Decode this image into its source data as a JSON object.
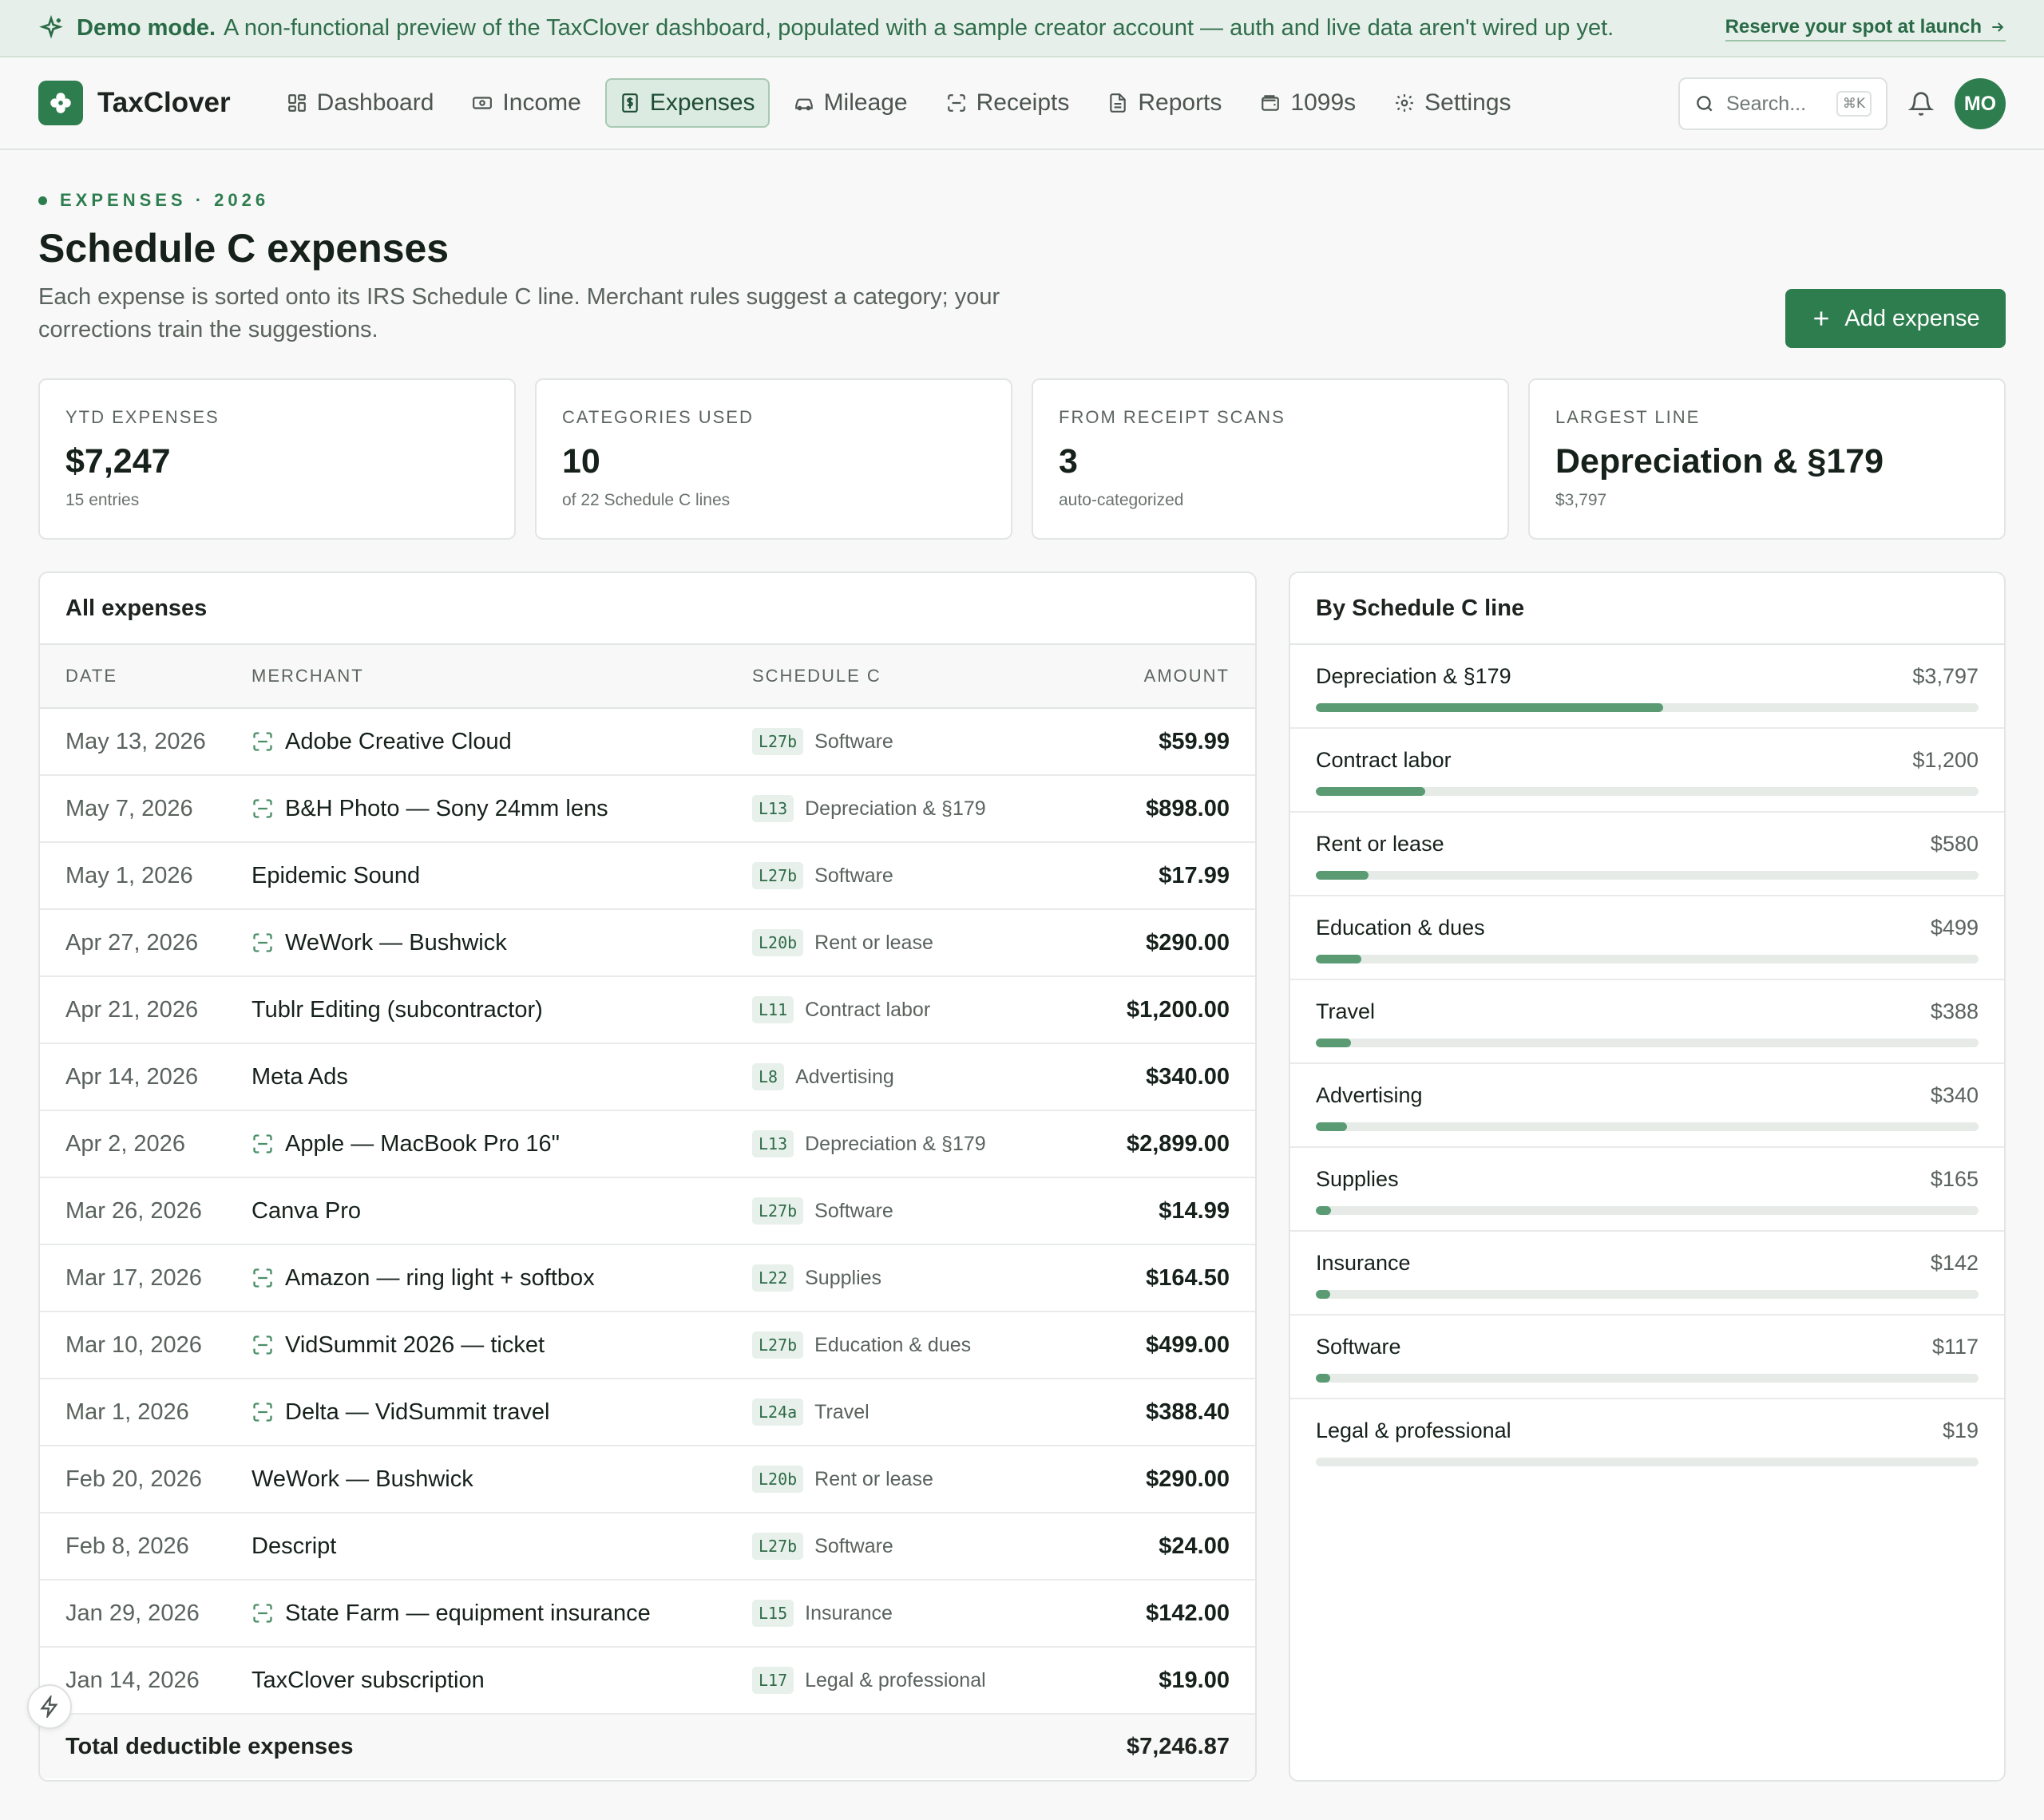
{
  "banner": {
    "strong": "Demo mode.",
    "message": "A non-functional preview of the TaxClover dashboard, populated with a sample creator account — auth and live data aren't wired up yet.",
    "cta": "Reserve your spot at launch"
  },
  "header": {
    "brand": "TaxClover",
    "nav": [
      {
        "label": "Dashboard",
        "icon": "grid-icon"
      },
      {
        "label": "Income",
        "icon": "cash-icon"
      },
      {
        "label": "Expenses",
        "icon": "receipt-dollar-icon",
        "active": true
      },
      {
        "label": "Mileage",
        "icon": "car-icon"
      },
      {
        "label": "Receipts",
        "icon": "scan-icon"
      },
      {
        "label": "Reports",
        "icon": "document-icon"
      },
      {
        "label": "1099s",
        "icon": "wallet-icon"
      },
      {
        "label": "Settings",
        "icon": "gear-icon"
      }
    ],
    "search_placeholder": "Search...",
    "search_shortcut": "⌘K",
    "avatar_initials": "MO"
  },
  "page": {
    "eyebrow": "EXPENSES · 2026",
    "title": "Schedule C expenses",
    "subtitle": "Each expense is sorted onto its IRS Schedule C line. Merchant rules suggest a category; your corrections train the suggestions.",
    "add_button": "Add expense"
  },
  "stats": [
    {
      "label": "YTD EXPENSES",
      "value": "$7,247",
      "note": "15 entries"
    },
    {
      "label": "CATEGORIES USED",
      "value": "10",
      "note": "of 22 Schedule C lines"
    },
    {
      "label": "FROM RECEIPT SCANS",
      "value": "3",
      "note": "auto-categorized"
    },
    {
      "label": "LARGEST LINE",
      "value": "Depreciation & §179",
      "note": "$3,797"
    }
  ],
  "expenses": {
    "title": "All expenses",
    "columns": [
      "DATE",
      "MERCHANT",
      "SCHEDULE C",
      "AMOUNT"
    ],
    "rows": [
      {
        "date": "May 13, 2026",
        "merchant": "Adobe Creative Cloud",
        "scanned": true,
        "line": "L27b",
        "category": "Software",
        "amount": "$59.99"
      },
      {
        "date": "May 7, 2026",
        "merchant": "B&H Photo — Sony 24mm lens",
        "scanned": true,
        "line": "L13",
        "category": "Depreciation & §179",
        "amount": "$898.00"
      },
      {
        "date": "May 1, 2026",
        "merchant": "Epidemic Sound",
        "scanned": false,
        "line": "L27b",
        "category": "Software",
        "amount": "$17.99"
      },
      {
        "date": "Apr 27, 2026",
        "merchant": "WeWork — Bushwick",
        "scanned": true,
        "line": "L20b",
        "category": "Rent or lease",
        "amount": "$290.00"
      },
      {
        "date": "Apr 21, 2026",
        "merchant": "Tublr Editing (subcontractor)",
        "scanned": false,
        "line": "L11",
        "category": "Contract labor",
        "amount": "$1,200.00"
      },
      {
        "date": "Apr 14, 2026",
        "merchant": "Meta Ads",
        "scanned": false,
        "line": "L8",
        "category": "Advertising",
        "amount": "$340.00"
      },
      {
        "date": "Apr 2, 2026",
        "merchant": "Apple — MacBook Pro 16\"",
        "scanned": true,
        "line": "L13",
        "category": "Depreciation & §179",
        "amount": "$2,899.00"
      },
      {
        "date": "Mar 26, 2026",
        "merchant": "Canva Pro",
        "scanned": false,
        "line": "L27b",
        "category": "Software",
        "amount": "$14.99"
      },
      {
        "date": "Mar 17, 2026",
        "merchant": "Amazon — ring light + softbox",
        "scanned": true,
        "line": "L22",
        "category": "Supplies",
        "amount": "$164.50"
      },
      {
        "date": "Mar 10, 2026",
        "merchant": "VidSummit 2026 — ticket",
        "scanned": true,
        "line": "L27b",
        "category": "Education & dues",
        "amount": "$499.00"
      },
      {
        "date": "Mar 1, 2026",
        "merchant": "Delta — VidSummit travel",
        "scanned": true,
        "line": "L24a",
        "category": "Travel",
        "amount": "$388.40"
      },
      {
        "date": "Feb 20, 2026",
        "merchant": "WeWork — Bushwick",
        "scanned": false,
        "line": "L20b",
        "category": "Rent or lease",
        "amount": "$290.00"
      },
      {
        "date": "Feb 8, 2026",
        "merchant": "Descript",
        "scanned": false,
        "line": "L27b",
        "category": "Software",
        "amount": "$24.00"
      },
      {
        "date": "Jan 29, 2026",
        "merchant": "State Farm — equipment insurance",
        "scanned": true,
        "line": "L15",
        "category": "Insurance",
        "amount": "$142.00"
      },
      {
        "date": "Jan 14, 2026",
        "merchant": "TaxClover subscription",
        "scanned": false,
        "line": "L17",
        "category": "Legal & professional",
        "amount": "$19.00"
      }
    ],
    "total_label": "Total deductible expenses",
    "total_amount": "$7,246.87"
  },
  "by_line": {
    "title": "By Schedule C line",
    "items": [
      {
        "name": "Depreciation & §179",
        "amount": "$3,797",
        "value": 3797
      },
      {
        "name": "Contract labor",
        "amount": "$1,200",
        "value": 1200
      },
      {
        "name": "Rent or lease",
        "amount": "$580",
        "value": 580
      },
      {
        "name": "Education & dues",
        "amount": "$499",
        "value": 499
      },
      {
        "name": "Travel",
        "amount": "$388",
        "value": 388
      },
      {
        "name": "Advertising",
        "amount": "$340",
        "value": 340
      },
      {
        "name": "Supplies",
        "amount": "$165",
        "value": 165
      },
      {
        "name": "Insurance",
        "amount": "$142",
        "value": 142
      },
      {
        "name": "Software",
        "amount": "$117",
        "value": 117
      },
      {
        "name": "Legal & professional",
        "amount": "$19",
        "value": 19
      }
    ],
    "bar_max": 7247
  },
  "colors": {
    "accent": "#2e7d4f",
    "bar": "#5a9b74",
    "banner_bg": "#e6efe9"
  }
}
